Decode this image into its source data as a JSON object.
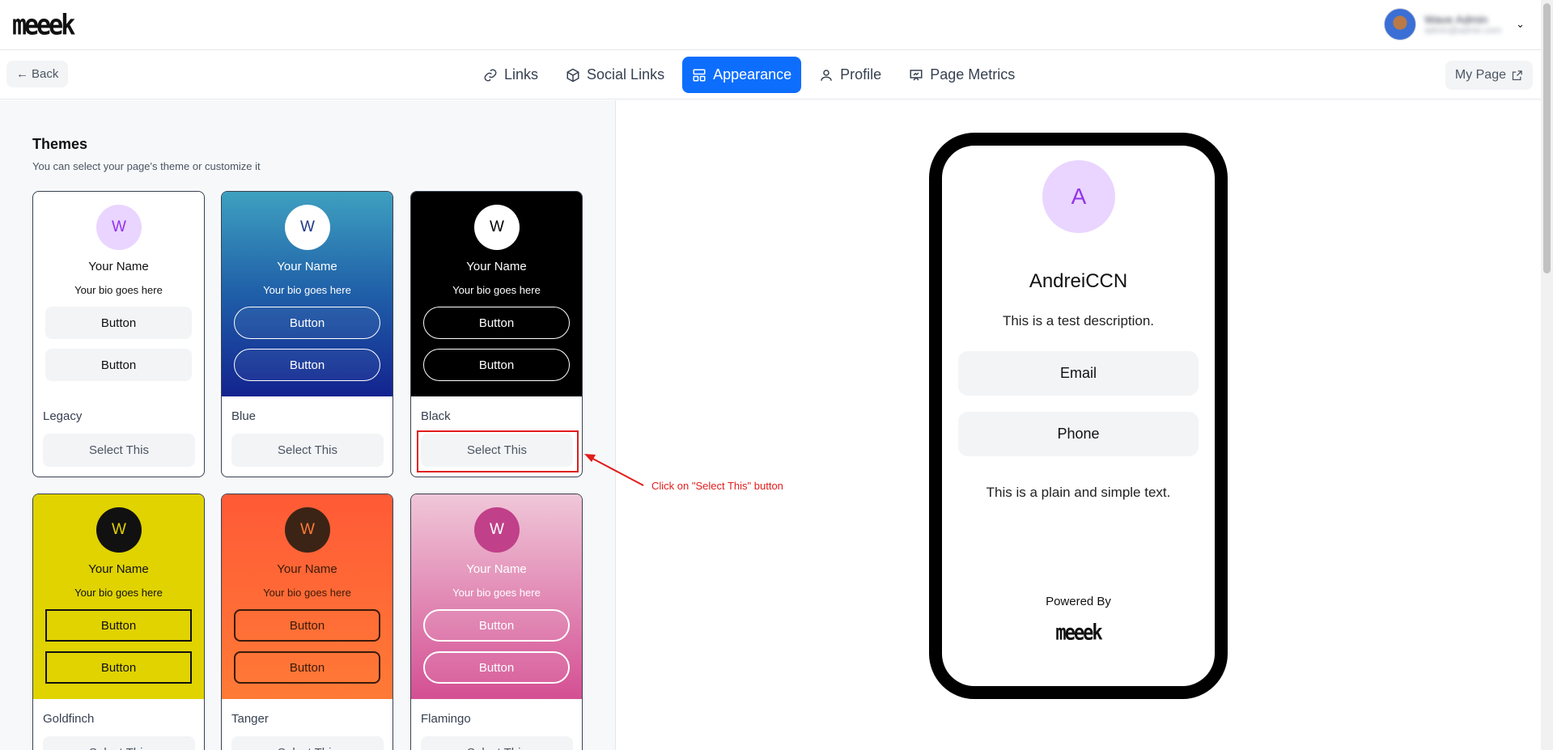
{
  "header": {
    "logo": "meeek",
    "user": {
      "name": "Wave Admin",
      "email": "admin@admin.com"
    }
  },
  "nav": {
    "back_label": "Back",
    "tabs": [
      {
        "label": "Links",
        "icon": "link-icon"
      },
      {
        "label": "Social Links",
        "icon": "cube-icon"
      },
      {
        "label": "Appearance",
        "icon": "layout-icon",
        "active": true
      },
      {
        "label": "Profile",
        "icon": "user-icon"
      },
      {
        "label": "Page Metrics",
        "icon": "presentation-chart-icon"
      }
    ],
    "my_page_label": "My Page"
  },
  "themes": {
    "title": "Themes",
    "subtitle": "You can select your page's theme or customize it",
    "items": [
      {
        "name": "Legacy",
        "avatar": "W",
        "your_name": "Your Name",
        "bio": "Your bio goes here",
        "button1": "Button",
        "button2": "Button",
        "select": "Select This"
      },
      {
        "name": "Blue",
        "avatar": "W",
        "your_name": "Your Name",
        "bio": "Your bio goes here",
        "button1": "Button",
        "button2": "Button",
        "select": "Select This"
      },
      {
        "name": "Black",
        "avatar": "W",
        "your_name": "Your Name",
        "bio": "Your bio goes here",
        "button1": "Button",
        "button2": "Button",
        "select": "Select This"
      },
      {
        "name": "Goldfinch",
        "avatar": "W",
        "your_name": "Your Name",
        "bio": "Your bio goes here",
        "button1": "Button",
        "button2": "Button",
        "select": "Select This"
      },
      {
        "name": "Tanger",
        "avatar": "W",
        "your_name": "Your Name",
        "bio": "Your bio goes here",
        "button1": "Button",
        "button2": "Button",
        "select": "Select This"
      },
      {
        "name": "Flamingo",
        "avatar": "W",
        "your_name": "Your Name",
        "bio": "Your bio goes here",
        "button1": "Button",
        "button2": "Button",
        "select": "Select This"
      }
    ]
  },
  "annotation": {
    "text": "Click on \"Select This\" button",
    "color": "#e11d1d"
  },
  "preview": {
    "avatar": "A",
    "name": "AndreiCCN",
    "description": "This is a test description.",
    "buttons": [
      "Email",
      "Phone"
    ],
    "text": "This is a plain and simple text.",
    "powered_by": "Powered By",
    "logo": "meeek"
  },
  "colors": {
    "accent": "#0d6efd",
    "annotation": "#e11d1d"
  }
}
